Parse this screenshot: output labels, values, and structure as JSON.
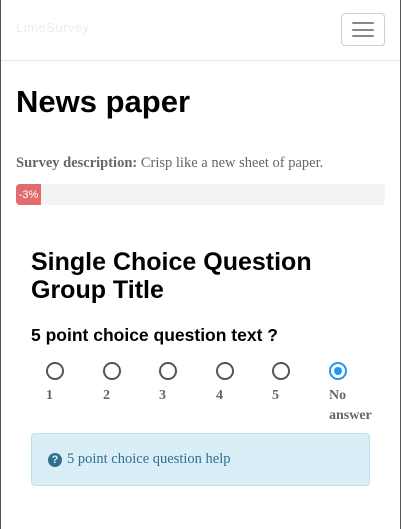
{
  "navbar": {
    "brand": "LimeSurvey",
    "menu_icon": "hamburger-icon"
  },
  "survey": {
    "title": "News paper",
    "description_label": "Survey description:",
    "description_text": "Crisp like a new sheet of paper."
  },
  "progress": {
    "label": "-3%",
    "value_percent": -3,
    "fill_color": "#e36b6b"
  },
  "group": {
    "title": "Single Choice Question Group Title"
  },
  "question": {
    "text": "5 point choice question text ?",
    "options": [
      {
        "label": "1",
        "selected": false
      },
      {
        "label": "2",
        "selected": false
      },
      {
        "label": "3",
        "selected": false
      },
      {
        "label": "4",
        "selected": false
      },
      {
        "label": "5",
        "selected": false
      },
      {
        "label": "No answer",
        "selected": true
      }
    ],
    "help_icon": "question-circle-icon",
    "help_text": "5 point choice question help"
  },
  "colors": {
    "radio_selected": "#2196f3",
    "help_bg": "#d9eef6",
    "help_text": "#31708f"
  }
}
